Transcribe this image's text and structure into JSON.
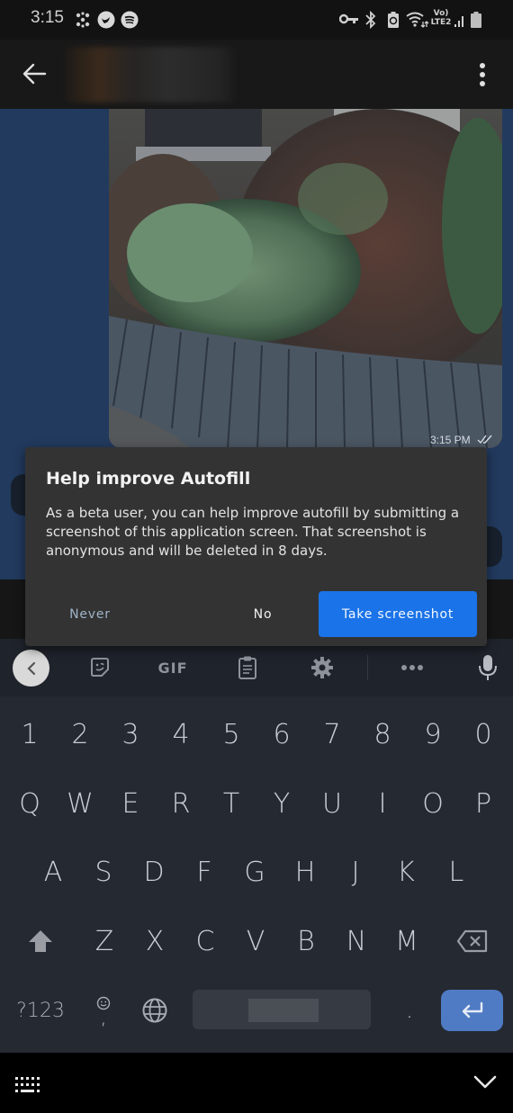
{
  "status_bar": {
    "time": "3:15",
    "left_icons": [
      "pinwheel-icon",
      "twitter-icon",
      "spotify-icon"
    ],
    "right_icons": [
      "vpn-key-icon",
      "bluetooth-icon",
      "battery-saver-icon",
      "wifi-icon",
      "volte-lte2-icon",
      "signal-icon",
      "battery-icon"
    ],
    "network_label_top": "Vo)",
    "network_label_bottom": "LTE2"
  },
  "app_bar": {
    "back_icon": "arrow-left-icon",
    "title_blurred": true,
    "menu_icon": "more-vert-icon"
  },
  "chat": {
    "photo_message": {
      "time": "3:15 PM",
      "status_icon": "double-check-icon"
    }
  },
  "dialog": {
    "title": "Help improve Autofill",
    "body": "As a beta user, you can help improve autofill by submitting a screenshot of this application screen. That screenshot is anonymous and will be deleted in 8 days.",
    "buttons": {
      "never": "Never",
      "no": "No",
      "take_screenshot": "Take screenshot"
    },
    "accent_color": "#1a73e8"
  },
  "keyboard": {
    "toolbar": {
      "gif_label": "GIF",
      "items": [
        "collapse-icon",
        "sticker-icon",
        "gif",
        "clipboard-icon",
        "settings-icon",
        "more-icon",
        "microphone-icon"
      ]
    },
    "rows": {
      "numbers": [
        "1",
        "2",
        "3",
        "4",
        "5",
        "6",
        "7",
        "8",
        "9",
        "0"
      ],
      "row1": [
        "Q",
        "W",
        "E",
        "R",
        "T",
        "Y",
        "U",
        "I",
        "O",
        "P"
      ],
      "row2": [
        "A",
        "S",
        "D",
        "F",
        "G",
        "H",
        "J",
        "K",
        "L"
      ],
      "row3": [
        "Z",
        "X",
        "C",
        "V",
        "B",
        "N",
        "M"
      ]
    },
    "bottom": {
      "symbols_label": "?123",
      "comma_label": ",",
      "period_label": "."
    },
    "enter_color": "#4f7bc4"
  },
  "nav_bar": {
    "left_icon": "keyboard-switch-icon",
    "right_icon": "chevron-down-icon"
  }
}
